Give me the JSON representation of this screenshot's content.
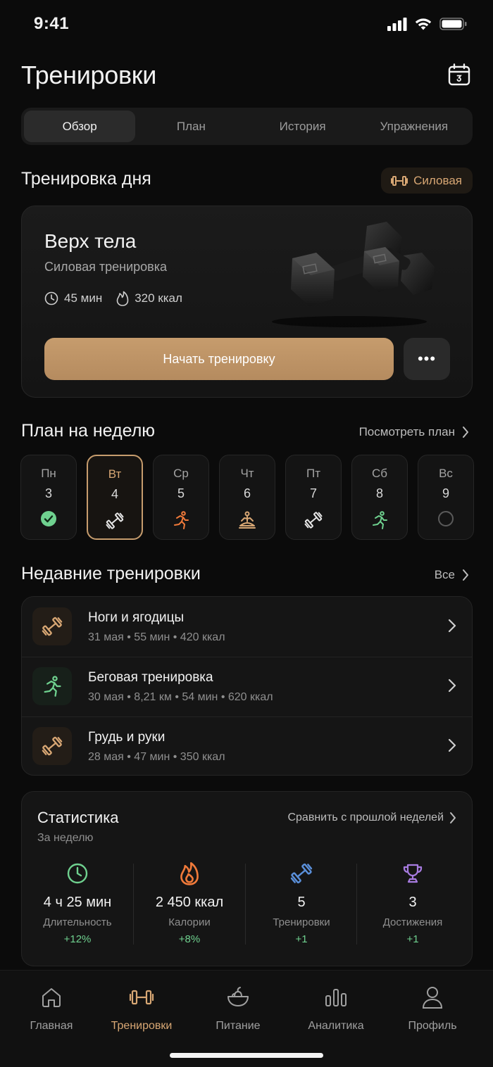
{
  "status": {
    "time": "9:41"
  },
  "header": {
    "title": "Тренировки"
  },
  "tabs": [
    {
      "label": "Обзор",
      "active": true
    },
    {
      "label": "План",
      "active": false
    },
    {
      "label": "История",
      "active": false
    },
    {
      "label": "Упражнения",
      "active": false
    }
  ],
  "day_workout": {
    "section_title": "Тренировка дня",
    "badge": "Силовая",
    "title": "Верх тела",
    "subtitle": "Силовая тренировка",
    "duration": "45 мин",
    "calories": "320 ккал",
    "start_label": "Начать тренировку",
    "more_label": "•••"
  },
  "week": {
    "title": "План на неделю",
    "link": "Посмотреть план",
    "days": [
      {
        "name": "Пн",
        "date": "3",
        "icon": "check-icon"
      },
      {
        "name": "Вт",
        "date": "4",
        "icon": "dumbbell-icon",
        "active": true
      },
      {
        "name": "Ср",
        "date": "5",
        "icon": "run-icon"
      },
      {
        "name": "Чт",
        "date": "6",
        "icon": "yoga-icon"
      },
      {
        "name": "Пт",
        "date": "7",
        "icon": "dumbbell-icon"
      },
      {
        "name": "Сб",
        "date": "8",
        "icon": "run-icon"
      },
      {
        "name": "Вс",
        "date": "9",
        "icon": "empty-circle-icon"
      }
    ]
  },
  "recent": {
    "title": "Недавние тренировки",
    "link": "Все",
    "items": [
      {
        "title": "Ноги и ягодицы",
        "meta": "31 мая • 55 мин • 420 ккал",
        "icon": "dumbbell-icon"
      },
      {
        "title": "Беговая тренировка",
        "meta": "30 мая • 8,21 км • 54 мин • 620 ккал",
        "icon": "run-icon"
      },
      {
        "title": "Грудь и руки",
        "meta": "28 мая • 47 мин • 350 ккал",
        "icon": "dumbbell-icon"
      }
    ]
  },
  "stats": {
    "title": "Статистика",
    "subtitle": "За неделю",
    "compare": "Сравнить с прошлой неделей",
    "items": [
      {
        "value": "4 ч 25 мин",
        "label": "Длительность",
        "delta": "+12%",
        "icon": "clock-icon",
        "color": "#6fd18f"
      },
      {
        "value": "2 450 ккал",
        "label": "Калории",
        "delta": "+8%",
        "icon": "flame-icon",
        "color": "#f07a3a"
      },
      {
        "value": "5",
        "label": "Тренировки",
        "delta": "+1",
        "icon": "dumbbell-icon",
        "color": "#5a8fd9"
      },
      {
        "value": "3",
        "label": "Достижения",
        "delta": "+1",
        "icon": "trophy-icon",
        "color": "#a77be0"
      }
    ]
  },
  "tabbar": [
    {
      "label": "Главная",
      "icon": "home-icon"
    },
    {
      "label": "Тренировки",
      "icon": "dumbbell-icon",
      "active": true
    },
    {
      "label": "Питание",
      "icon": "bowl-icon"
    },
    {
      "label": "Аналитика",
      "icon": "bar-chart-icon"
    },
    {
      "label": "Профиль",
      "icon": "person-icon"
    }
  ],
  "colors": {
    "accent": "#c69c6d",
    "accent_text": "#d8a774",
    "success": "#6fd18f",
    "background": "#0b0b0b"
  }
}
